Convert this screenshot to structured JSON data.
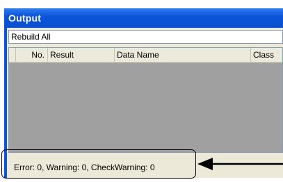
{
  "window": {
    "title": "Output"
  },
  "toolbar": {
    "dropdown_value": "Rebuild All"
  },
  "table": {
    "columns": [
      "",
      "No.",
      "Result",
      "Data Name",
      "Class"
    ],
    "rows": []
  },
  "status": {
    "text": "Error: 0, Warning: 0, CheckWarning: 0"
  },
  "colors": {
    "title_bar": "#0b55d8",
    "client_bg": "#ece9d8",
    "list_bg": "#a0a0a0"
  }
}
